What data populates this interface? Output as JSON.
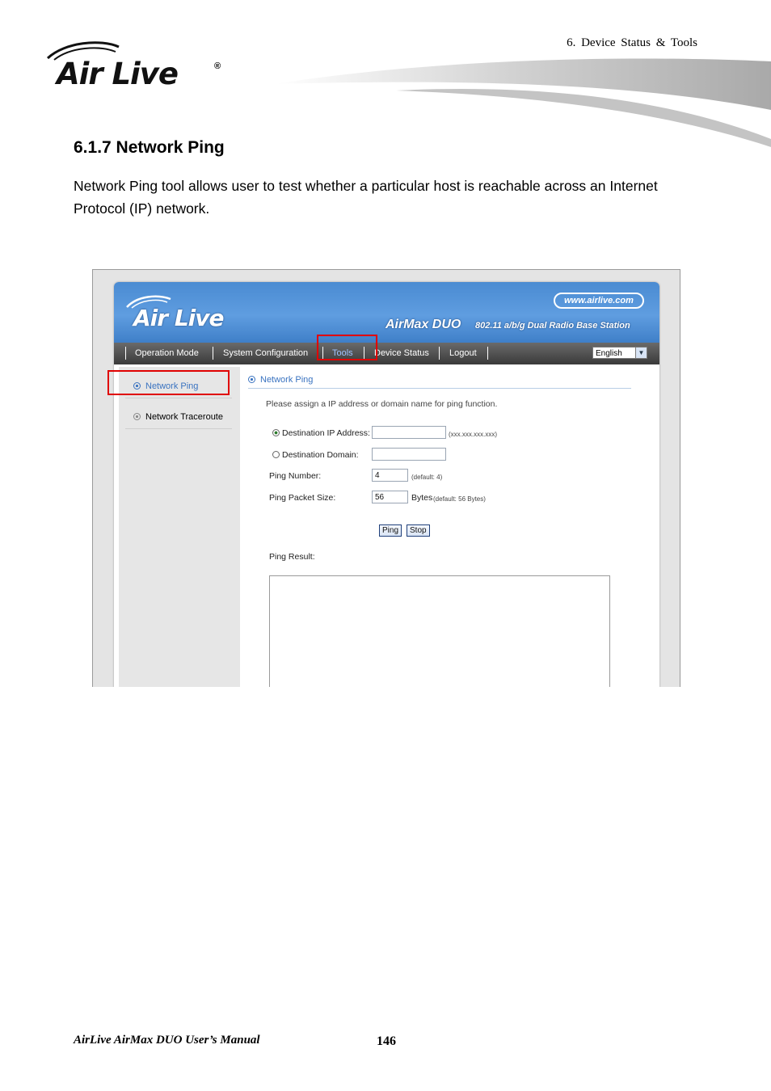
{
  "header": {
    "chapter": "6.  Device  Status  &  Tools",
    "logo_text": "Air Live",
    "logo_reg": "®"
  },
  "section": {
    "heading": "6.1.7 Network Ping",
    "paragraph": "Network Ping tool allows user to test whether a particular host is reachable across an Internet Protocol (IP) network."
  },
  "screenshot": {
    "banner": {
      "logo": "Air Live",
      "url": "www.airlive.com",
      "product": "AirMax DUO",
      "product_desc": "802.11 a/b/g Dual Radio Base Station"
    },
    "nav": {
      "items": [
        "Operation Mode",
        "System Configuration",
        "Tools",
        "Device Status",
        "Logout"
      ],
      "active": "Tools",
      "language": "English"
    },
    "sidebar": {
      "items": [
        "Network Ping",
        "Network Traceroute"
      ],
      "active": "Network Ping"
    },
    "content": {
      "title": "Network Ping",
      "description": "Please assign a IP address or domain name for ping function.",
      "dest_ip_label": "Destination IP Address:",
      "dest_ip_value": "",
      "dest_ip_hint": "(xxx.xxx.xxx.xxx)",
      "dest_domain_label": "Destination Domain:",
      "dest_domain_value": "",
      "ping_number_label": "Ping Number:",
      "ping_number_value": "4",
      "ping_number_hint": "(default: 4)",
      "packet_size_label": "Ping Packet Size:",
      "packet_size_value": "56",
      "packet_size_unit": "Bytes",
      "packet_size_hint": "(default: 56 Bytes)",
      "ping_button": "Ping",
      "stop_button": "Stop",
      "result_label": "Ping Result:",
      "result_text": ""
    }
  },
  "colors": {
    "banner_blue": "#5f9de0",
    "nav_dark": "#3a3a3a",
    "link_blue": "#3a73c0",
    "highlight_red": "#e00000"
  },
  "footer": {
    "manual": "AirLive AirMax DUO User’s Manual",
    "page": "146"
  }
}
